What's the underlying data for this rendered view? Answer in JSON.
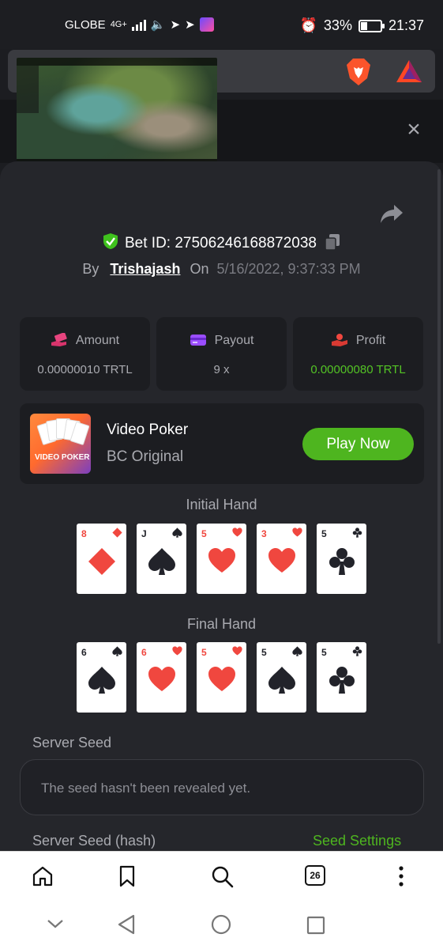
{
  "status_bar": {
    "carrier": "GLOBE",
    "network": "4G+",
    "battery": "33%",
    "time": "21:37"
  },
  "browser": {
    "icons": [
      "brave-lion-icon",
      "bat-rewards-icon"
    ]
  },
  "video": {
    "description_icons": [
      "pip-video"
    ]
  },
  "bet": {
    "id_label": "Bet ID: 27506246168872038",
    "by_label": "By",
    "user": "Trishajash",
    "on_label": "On",
    "date": "5/16/2022, 9:37:33 PM"
  },
  "stats": [
    {
      "label": "Amount",
      "value": "0.00000010 TRTL",
      "icon": "money-hand-icon"
    },
    {
      "label": "Payout",
      "value": "9 x",
      "icon": "card-icon"
    },
    {
      "label": "Profit",
      "value": "0.00000080 TRTL",
      "icon": "hand-coin-icon"
    }
  ],
  "game": {
    "name": "Video Poker",
    "provider": "BC Original",
    "cta": "Play Now",
    "thumb_text": "VIDEO POKER"
  },
  "initial_hand": {
    "title": "Initial Hand",
    "cards": [
      {
        "rank": "8",
        "suit": "diamond"
      },
      {
        "rank": "J",
        "suit": "spade"
      },
      {
        "rank": "5",
        "suit": "heart"
      },
      {
        "rank": "3",
        "suit": "heart"
      },
      {
        "rank": "5",
        "suit": "club"
      }
    ]
  },
  "final_hand": {
    "title": "Final Hand",
    "cards": [
      {
        "rank": "6",
        "suit": "spade"
      },
      {
        "rank": "6",
        "suit": "heart"
      },
      {
        "rank": "5",
        "suit": "heart"
      },
      {
        "rank": "5",
        "suit": "spade"
      },
      {
        "rank": "5",
        "suit": "club"
      }
    ]
  },
  "server_seed": {
    "label": "Server Seed",
    "placeholder": "The seed hasn't been revealed yet."
  },
  "server_seed_hash": {
    "label": "Server Seed (hash)",
    "settings": "Seed Settings"
  },
  "bottom_nav": {
    "tab_count": "26"
  },
  "colors": {
    "accent_green": "#4eb51f",
    "card_red": "#f0473f",
    "sheet_bg": "#25262b"
  }
}
